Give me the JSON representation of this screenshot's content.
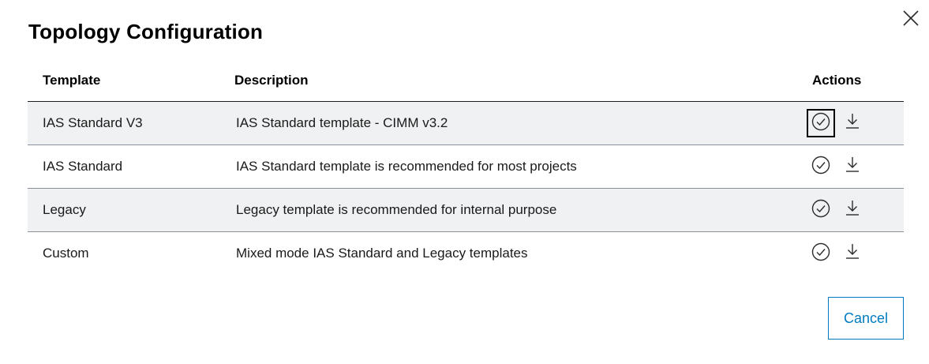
{
  "dialog": {
    "title": "Topology Configuration",
    "close_icon": "close-icon"
  },
  "table": {
    "headers": {
      "template": "Template",
      "description": "Description",
      "actions": "Actions"
    },
    "rows": [
      {
        "template": "IAS Standard V3",
        "description": "IAS Standard template - CIMM v3.2",
        "shaded": true,
        "select_focused": true
      },
      {
        "template": "IAS Standard",
        "description": "IAS Standard template is recommended for most projects",
        "shaded": false,
        "select_focused": false
      },
      {
        "template": "Legacy",
        "description": "Legacy template is recommended for internal purpose",
        "shaded": true,
        "select_focused": false
      },
      {
        "template": "Custom",
        "description": "Mixed mode IAS Standard and Legacy templates",
        "shaded": false,
        "select_focused": false
      }
    ],
    "action_icons": {
      "select": "check-circle-icon",
      "download": "download-icon"
    }
  },
  "footer": {
    "cancel_label": "Cancel"
  },
  "colors": {
    "accent": "#007bc0",
    "row_shade": "#eff1f2",
    "text": "#1a1a1a"
  }
}
